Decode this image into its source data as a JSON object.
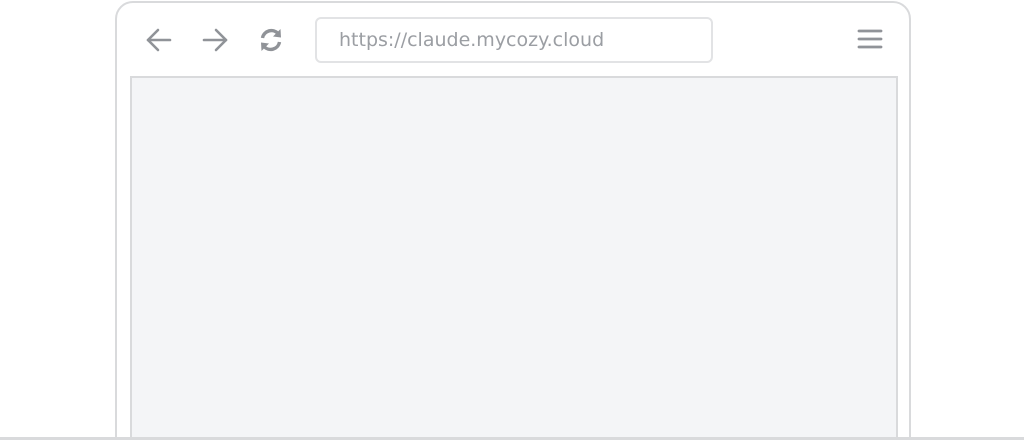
{
  "browser": {
    "address_bar": {
      "url": "https://claude.mycozy.cloud"
    },
    "toolbar": {
      "back_icon": "arrow-left-icon",
      "forward_icon": "arrow-right-icon",
      "reload_icon": "reload-icon",
      "menu_icon": "hamburger-menu-icon"
    }
  },
  "colors": {
    "frame_border": "#d9dadc",
    "icon": "#909398",
    "url_text": "#9b9ea3",
    "viewport_bg": "#f4f5f7"
  }
}
